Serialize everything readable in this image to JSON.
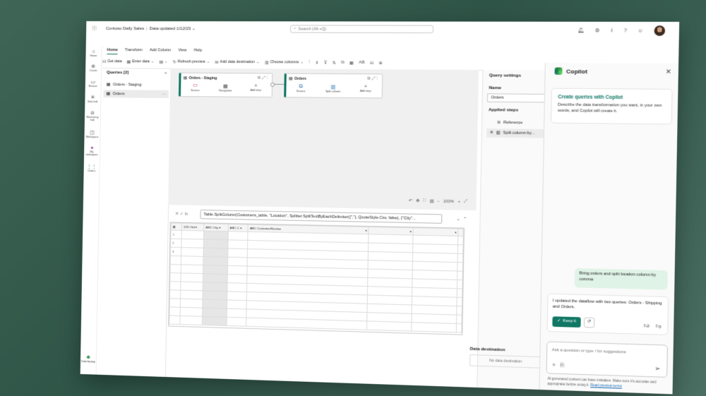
{
  "header": {
    "app_title": "Contoso Daily Sales",
    "data_updated": "Data updated 1/12/23",
    "search_placeholder": "Search (Alt +Q)"
  },
  "tabs": [
    "Home",
    "Transform",
    "Add Column",
    "View",
    "Help"
  ],
  "ribbon": {
    "get_data": "Get data",
    "enter_data": "Enter data",
    "refresh_preview": "Refresh preview",
    "add_data_destination": "Add data destination",
    "choose_columns": "Choose columns",
    "ab_label": "AB"
  },
  "sidebar": {
    "items": [
      {
        "label": "Home",
        "icon": "home-icon"
      },
      {
        "label": "Create",
        "icon": "plus-icon"
      },
      {
        "label": "Browse",
        "icon": "folder-icon"
      },
      {
        "label": "Data hub",
        "icon": "data-hub-icon"
      },
      {
        "label": "Monitoring hub",
        "icon": "monitor-icon"
      },
      {
        "label": "Workspace",
        "icon": "workspace-icon"
      },
      {
        "label": "My workspace",
        "icon": "person-icon"
      },
      {
        "label": "Orders",
        "icon": "dataflow-icon"
      }
    ],
    "brand_label": "Data factory"
  },
  "queries": {
    "header": "Queries [2]",
    "items": [
      "Orders - Staging",
      "Orders"
    ]
  },
  "diagram": {
    "cards": [
      {
        "name": "Orders - Staging",
        "steps": [
          "Source",
          "Navigation",
          "Add step"
        ]
      },
      {
        "name": "Orders",
        "steps": [
          "Source",
          "Split column",
          "Add step"
        ]
      }
    ],
    "zoom": "100%"
  },
  "formula": {
    "fx": "fx",
    "text": "Table.SplitColumn(Customers_table, \"Location\", Splitter.SplitTextByEachDelimiter({\",\"}, QuoteStyle.Csv, false), {\"City\"..."
  },
  "grid": {
    "columns": [
      "Ord",
      "City",
      "C",
      "CustomerReview",
      "",
      ""
    ],
    "rows": [
      "1",
      "2",
      "3"
    ]
  },
  "settings": {
    "title": "Query settings",
    "name_label": "Name",
    "name_value": "Orders",
    "applied_steps_label": "Applied steps",
    "steps": [
      "Reference",
      "Split column by..."
    ],
    "data_destination_label": "Data destination",
    "no_destination": "No data destination"
  },
  "copilot": {
    "title": "Copilot",
    "intro_title": "Create queries with Copilot",
    "intro_desc": "Describe the data transformation you want, in your own words, and Copilot will create it.",
    "user_message": "Bring orders and split location column by comma",
    "assistant_message": "I updated the dataflow with two queries: Orders - Shipping and Orders.",
    "keep_label": "Keep it",
    "input_placeholder": "Ask a question or type / for suggestions",
    "disclaimer": "AI-generated content can have mistakes. Make sure it's accurate and appropriate before using it.",
    "preview_terms": "Read preview terms"
  },
  "colors": {
    "accent": "#117865",
    "background": "#2e5447"
  }
}
